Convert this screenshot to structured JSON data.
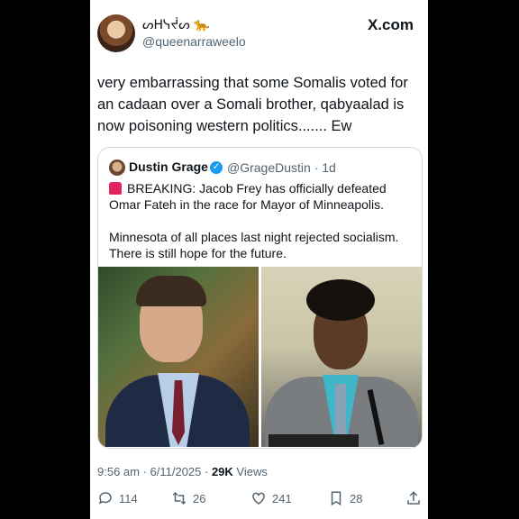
{
  "author": {
    "display_name": "ᔕᕼᓭᔫᔕ 🐆",
    "handle": "@queenarraweelo"
  },
  "brand": "X.com",
  "tweet_text": "very embarrassing that some Somalis voted for an cadaan over a Somali brother, qabyaalad is now poisoning western politics....... Ew",
  "quote": {
    "name": "Dustin Grage",
    "handle_time": "@GrageDustin · 1d",
    "line1": "BREAKING: Jacob Frey has officially defeated Omar Fateh in the race for Mayor of Minneapolis.",
    "line2": "Minnesota of all places last night rejected socialism. There is still hope for the future."
  },
  "meta": {
    "time_date": "9:56 am · 6/11/2025 · ",
    "views_count": "29K",
    "views_label": " Views"
  },
  "actions": {
    "replies": "114",
    "reposts": "26",
    "likes": "241",
    "bookmarks": "28"
  },
  "icons": [
    "reply-icon",
    "repost-icon",
    "like-icon",
    "bookmark-icon",
    "share-icon",
    "verified-icon",
    "siren-icon"
  ],
  "colors": {
    "verified": "#1d9bf0",
    "text": "#0f1419",
    "muted": "#536471",
    "border": "#cfd9de"
  }
}
